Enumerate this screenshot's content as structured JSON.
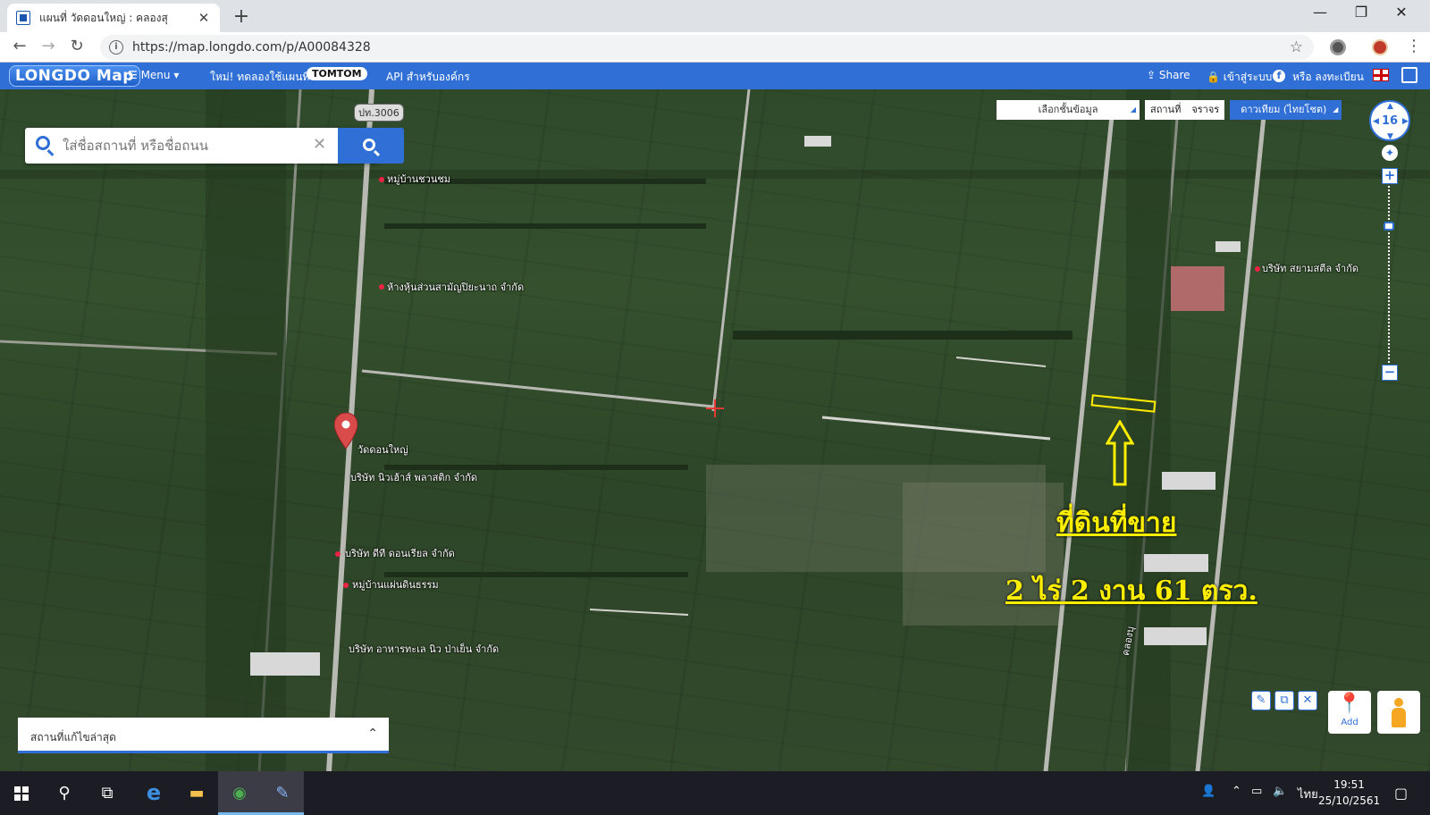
{
  "browser": {
    "tab_title": "แผนที่ วัดดอนใหญ่ : คลองสุ",
    "tab_close": "✕",
    "new_tab": "+",
    "url": "https://map.longdo.com/p/A00084328",
    "win_minimize": "—",
    "win_restore": "❐",
    "win_close": "✕",
    "back": "←",
    "forward": "→",
    "reload": "↻",
    "star": "☆",
    "kebab": "⋮"
  },
  "header": {
    "logo": "LONGDO Map",
    "menu": "☰ Menu ▾",
    "promo": "ใหม่! ทดลองใช้แผนที่",
    "tomtom": "TOMTOM",
    "api": "API สำหรับองค์กร",
    "share": "⇪ Share",
    "login": "🔒 เข้าสู่ระบบ",
    "register": "หรือ ลงทะเบียน",
    "facebook": "f"
  },
  "search": {
    "placeholder": "ใส่ชื่อสถานที่ หรือชื่อถนน",
    "clear": "✕"
  },
  "layers": {
    "select": "เลือกชั้นข้อมูล",
    "place": "สถานที่",
    "traffic": "จราจร",
    "satellite": "ดาวเทียม (ไทยโชต)"
  },
  "zoom": {
    "level": "16",
    "plus": "+",
    "minus": "−",
    "street_view": "✦"
  },
  "map_labels": {
    "road_3006": "ปท.3006",
    "village_1": "หมู่บ้านชวนชม",
    "company_1": "ห้างหุ้นส่วนสามัญปิยะนาถ จำกัด",
    "company_2": "บริษัท สยามสตีล จำกัด",
    "temple": "วัดดอนใหญ่",
    "company_3": "บริษัท นิวเฮ้าส์ พลาสติก จำกัด",
    "company_4": "บริษัท ดีที ดอนเรียล จำกัด",
    "village_2": "หมู่บ้านแผ่นดินธรรม",
    "company_5": "บริษัท อาหารทะเล นิว ป่าเย็น จำกัด",
    "canal": "คลองบุ"
  },
  "annotation": {
    "label": "ที่ดินที่ขาย",
    "area": "2 ไร่ 2 งาน 61 ตรว.",
    "color": "#ffee00"
  },
  "tools": {
    "tool1": "✎",
    "tool2": "⧉",
    "tool3": "✕",
    "add_pin": "📍",
    "add_label": "Add"
  },
  "recent": {
    "label": "สถานที่แก้ไขล่าสุด",
    "chevron": "⌃"
  },
  "taskbar": {
    "search": "⚲",
    "taskview": "⧉",
    "edge": "e",
    "explorer": "▬",
    "chrome": "◉",
    "paint": "✎",
    "people": "👤",
    "tray_up": "⌃",
    "network": "▭",
    "volume": "🔈",
    "lang": "ไทย",
    "time": "19:51",
    "date": "25/10/2561",
    "notifications": "▢"
  }
}
